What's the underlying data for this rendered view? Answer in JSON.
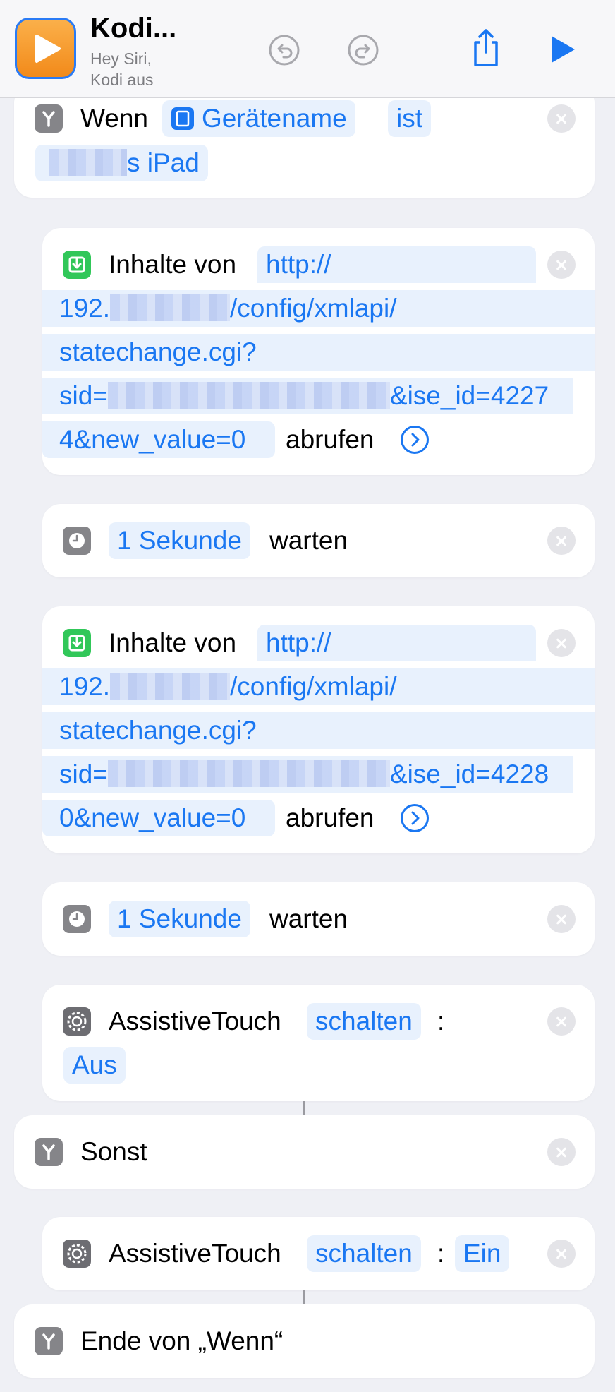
{
  "header": {
    "title": "Kodi...",
    "subtitle_line1": "Hey Siri,",
    "subtitle_line2": "Kodi aus"
  },
  "if_block": {
    "keyword": "Wenn",
    "field": "Gerätename",
    "operator": "ist",
    "value_suffix": "s iPad"
  },
  "fetch1": {
    "label": "Inhalte von",
    "url_line1": "http://",
    "url_line2_prefix": "192.",
    "url_line2_suffix": "/config/xmlapi/",
    "url_line3": "statechange.cgi?",
    "url_line4_prefix": "sid=",
    "url_line4_suffix": "&ise_id=4227",
    "url_line5": "4&new_value=0",
    "action": "abrufen"
  },
  "wait1": {
    "duration": "1 Sekunde",
    "label": "warten"
  },
  "fetch2": {
    "label": "Inhalte von",
    "url_line1": "http://",
    "url_line2_prefix": "192.",
    "url_line2_suffix": "/config/xmlapi/",
    "url_line3": "statechange.cgi?",
    "url_line4_prefix": "sid=",
    "url_line4_suffix": "&ise_id=4228",
    "url_line5": "0&new_value=0",
    "action": "abrufen"
  },
  "wait2": {
    "duration": "1 Sekunde",
    "label": "warten"
  },
  "assistive1": {
    "label": "AssistiveTouch",
    "mode": "schalten",
    "colon": ":",
    "value": "Aus"
  },
  "else_block": {
    "keyword": "Sonst"
  },
  "assistive2": {
    "label": "AssistiveTouch",
    "mode": "schalten",
    "colon": ":",
    "value": "Ein"
  },
  "end_block": {
    "label": "Ende von „Wenn“"
  },
  "colors": {
    "accent": "#1a77f2",
    "pill_bg": "#e8f1fd",
    "background": "#eff0f5"
  }
}
